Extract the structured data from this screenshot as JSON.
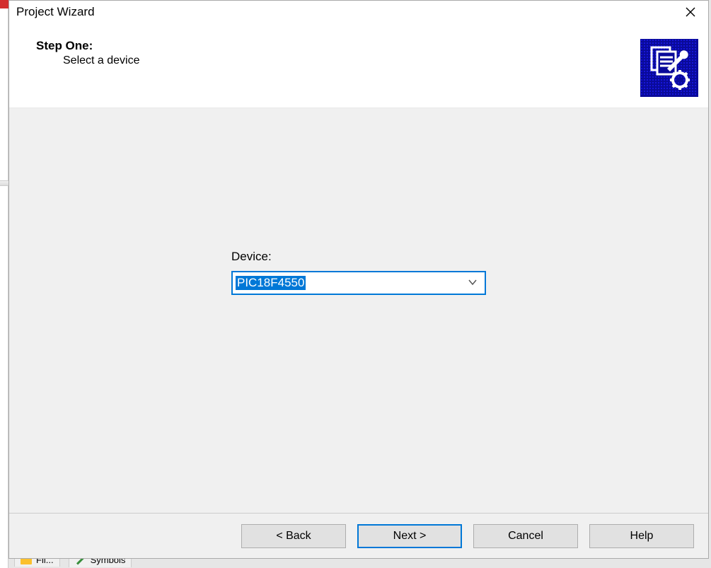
{
  "dialog": {
    "title": "Project Wizard",
    "step_title": "Step One:",
    "step_subtitle": "Select a device",
    "wizard_icon_name": "document-wrench-gear"
  },
  "form": {
    "device_label": "Device:",
    "device_value": "PIC18F4550"
  },
  "footer": {
    "back_label": "< Back",
    "next_label": "Next >",
    "cancel_label": "Cancel",
    "help_label": "Help"
  },
  "background": {
    "tab1_label": "Fil...",
    "tab2_label": "Symbols"
  }
}
